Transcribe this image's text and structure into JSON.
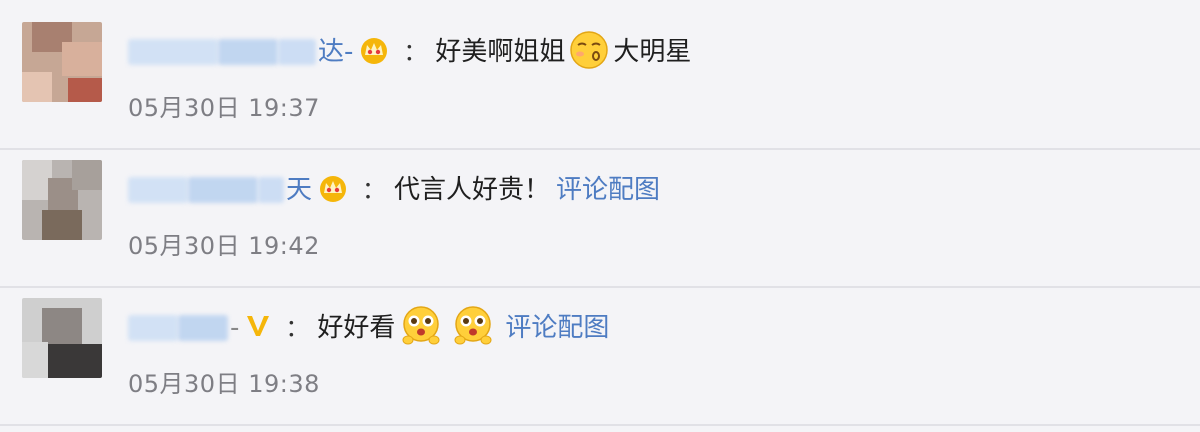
{
  "comments": [
    {
      "name_tail": "达-",
      "colon": "：",
      "text": "好美啊姐姐",
      "after_emoji_text": "大明星",
      "link": "",
      "time": "05月30日 19:37",
      "badge": "crown-icon",
      "emojis": [
        "kiss-face-emoji"
      ]
    },
    {
      "name_tail": "天",
      "colon": "：",
      "text": "代言人好贵！",
      "after_emoji_text": "",
      "link": "评论配图",
      "time": "05月30日 19:42",
      "badge": "crown-icon",
      "emojis": []
    },
    {
      "name_tail": "-",
      "colon": "：",
      "text": "好好看",
      "after_emoji_text": "",
      "link": "评论配图",
      "time": "05月30日 19:38",
      "badge": "verified-v-icon",
      "emojis": [
        "pleading-face-emoji",
        "pleading-face-emoji"
      ]
    }
  ],
  "colors": {
    "background": "#f4f4f7",
    "link": "#4e7cc2",
    "time": "#7e7e84",
    "badge_gold": "#f5b60a"
  }
}
